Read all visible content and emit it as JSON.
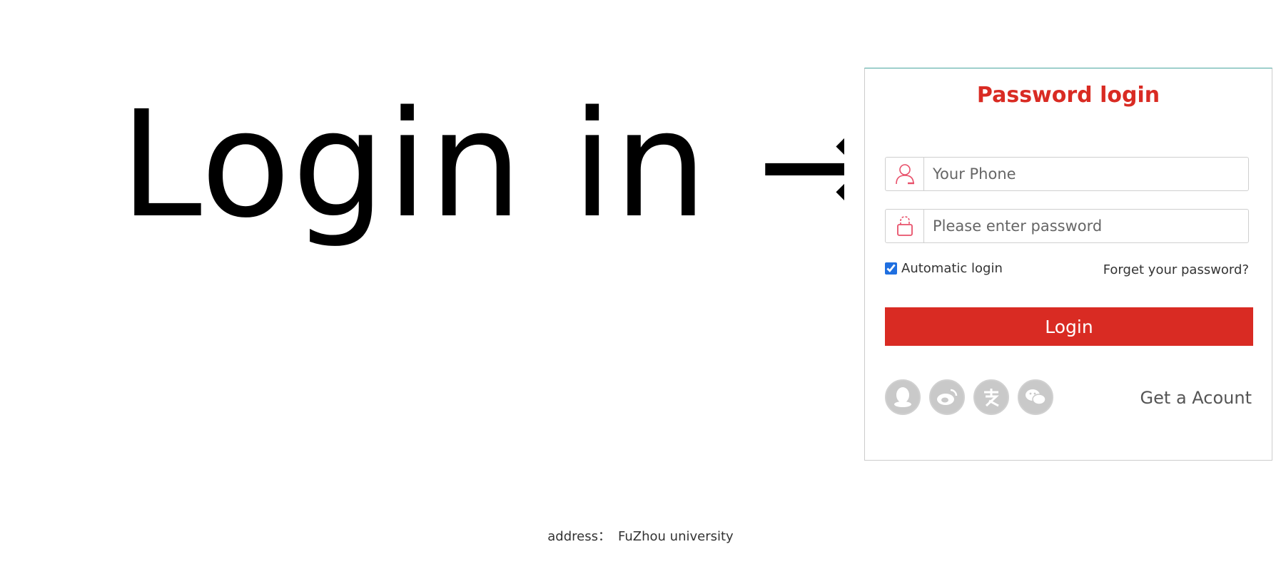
{
  "hero": {
    "text": "Login in →"
  },
  "panel": {
    "title": "Password login",
    "phone_placeholder": "Your Phone",
    "password_placeholder": "Please enter password",
    "auto_login_label": "Automatic login",
    "auto_login_checked": true,
    "forget_label": "Forget your password?",
    "login_label": "Login",
    "social_icons": [
      "qq-icon",
      "weibo-icon",
      "alipay-icon",
      "wechat-icon"
    ],
    "get_account_label": "Get a Acount"
  },
  "footer": {
    "address_label": "address：",
    "address_value": "FuZhou university"
  },
  "colors": {
    "accent": "#d92b23",
    "icon_pink": "#e8506a",
    "social_gray": "#c9c9c9"
  }
}
